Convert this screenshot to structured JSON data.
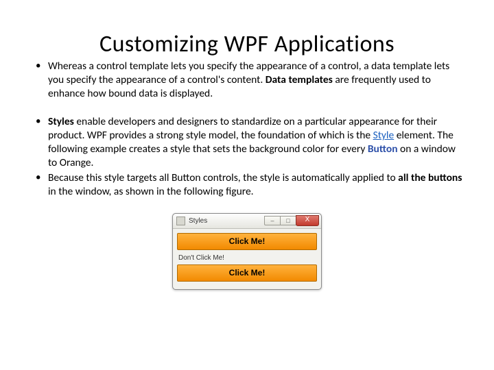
{
  "title": "Customizing WPF Applications",
  "bullets": {
    "b1_pre": "Whereas a control template lets you specify the appearance of a control, a data template lets you specify the appearance of a control's content. ",
    "b1_bold": "Data templates",
    "b1_post": " are frequently used to enhance how bound data is displayed.",
    "b2_bold1": "Styles",
    "b2_mid1": " enable developers and designers to standardize on a particular appearance for their product. WPF provides a strong style model, the foundation of which is the ",
    "b2_link": "Style",
    "b2_mid2": " element. The following example creates a style that sets the background color for every ",
    "b2_bold2": "Button",
    "b2_mid3": " on a window to Orange.",
    "b3_pre": "Because this style targets all Button controls, the style is automatically applied to ",
    "b3_bold": "all the buttons",
    "b3_post": " in the window, as shown in the following figure."
  },
  "window": {
    "title": "Styles",
    "close_glyph": "X",
    "min_glyph": "–",
    "max_glyph": "□",
    "button1": "Click Me!",
    "label": "Don't Click Me!",
    "button2": "Click Me!"
  }
}
